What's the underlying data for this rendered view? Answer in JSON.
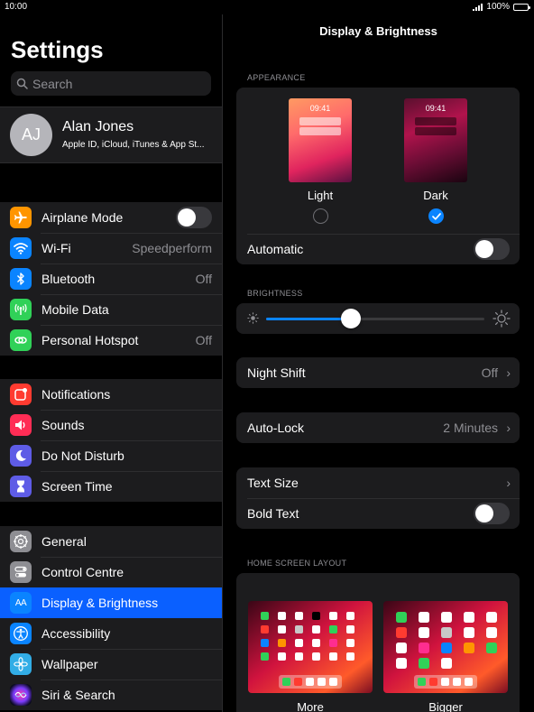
{
  "status_bar": {
    "time": "10:00",
    "battery": "100%"
  },
  "sidebar": {
    "title": "Settings",
    "search": {
      "placeholder": "Search"
    },
    "profile": {
      "initials": "AJ",
      "name": "Alan Jones",
      "subtitle": "Apple ID, iCloud, iTunes & App St..."
    },
    "groups": [
      [
        {
          "label": "Airplane Mode",
          "icon": "airplane-icon",
          "color": "#ff9500",
          "toggle": false
        },
        {
          "label": "Wi-Fi",
          "icon": "wifi-icon",
          "color": "#0a84ff",
          "value": "Speedperform"
        },
        {
          "label": "Bluetooth",
          "icon": "bluetooth-icon",
          "color": "#0a84ff",
          "value": "Off"
        },
        {
          "label": "Mobile Data",
          "icon": "antenna-icon",
          "color": "#30d158"
        },
        {
          "label": "Personal Hotspot",
          "icon": "hotspot-icon",
          "color": "#30d158",
          "value": "Off"
        }
      ],
      [
        {
          "label": "Notifications",
          "icon": "notifications-icon",
          "color": "#ff3b30"
        },
        {
          "label": "Sounds",
          "icon": "speaker-icon",
          "color": "#ff2d55"
        },
        {
          "label": "Do Not Disturb",
          "icon": "moon-icon",
          "color": "#5e5ce6"
        },
        {
          "label": "Screen Time",
          "icon": "hourglass-icon",
          "color": "#5e5ce6"
        }
      ],
      [
        {
          "label": "General",
          "icon": "gear-icon",
          "color": "#8e8e93"
        },
        {
          "label": "Control Centre",
          "icon": "switches-icon",
          "color": "#8e8e93"
        },
        {
          "label": "Display & Brightness",
          "icon": "text-size-icon",
          "color": "#0a84ff",
          "selected": true
        },
        {
          "label": "Accessibility",
          "icon": "accessibility-icon",
          "color": "#0a84ff"
        },
        {
          "label": "Wallpaper",
          "icon": "flower-icon",
          "color": "#32ade6"
        },
        {
          "label": "Siri & Search",
          "icon": "siri-icon",
          "color": "#1c1c1e"
        }
      ]
    ]
  },
  "detail": {
    "title": "Display & Brightness",
    "appearance": {
      "header": "APPEARANCE",
      "light": {
        "label": "Light",
        "time": "09:41",
        "selected": false
      },
      "dark": {
        "label": "Dark",
        "time": "09:41",
        "selected": true
      },
      "automatic_label": "Automatic",
      "automatic_on": false
    },
    "brightness": {
      "header": "BRIGHTNESS",
      "level": 0.39
    },
    "night_shift": {
      "label": "Night Shift",
      "value": "Off"
    },
    "auto_lock": {
      "label": "Auto-Lock",
      "value": "2 Minutes"
    },
    "text_size": {
      "label": "Text Size"
    },
    "bold_text": {
      "label": "Bold Text",
      "on": false
    },
    "home_layout": {
      "header": "HOME SCREEN LAYOUT",
      "options": [
        "More",
        "Bigger"
      ]
    }
  },
  "colors": {
    "accent": "#0a84ff",
    "selected_row": "#0a60ff",
    "cell": "#1c1c1e"
  }
}
